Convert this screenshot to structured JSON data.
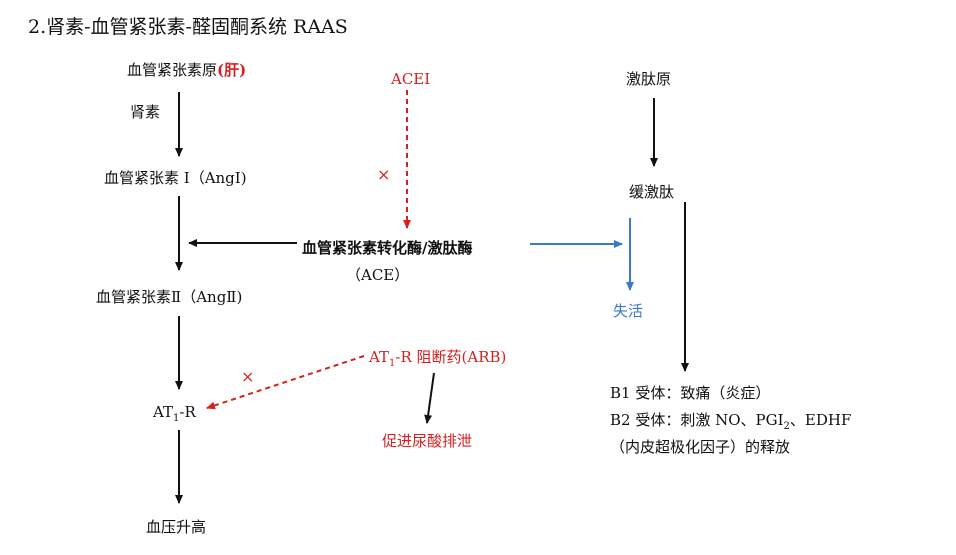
{
  "title": "2.肾素-血管紧张素-醛固酮系统 RAAS",
  "colors": {
    "black": "#111111",
    "red": "#d62020",
    "blue": "#3a78c9"
  },
  "left_column": {
    "angiotensinogen": "血管紧张素原",
    "liver_tag": "(肝)",
    "renin": "肾素",
    "ang1": "血管紧张素 I（AngI)",
    "ang2": "血管紧张素Ⅱ（AngⅡ)",
    "at1r_prefix": "AT",
    "at1r_sub": "1",
    "at1r_suffix": "-R",
    "bp_rise": "血压升高"
  },
  "middle_column": {
    "acei": "ACEI",
    "x_mark": "×",
    "ace_line1": "血管紧张素转化酶/激肽酶",
    "ace_line2": "（ACE）",
    "arb_prefix": "AT",
    "arb_sub": "1",
    "arb_suffix": "-R 阻断药(ARB)",
    "promote_uric": "促进尿酸排泄"
  },
  "right_column": {
    "kininogen": "激肽原",
    "bradykinin": "缓激肽",
    "inactivation": "失活",
    "b1": "B1 受体：致痛（炎症）",
    "b2_prefix": "B2 受体：刺激 NO、PGI",
    "b2_sub": "2",
    "b2_suffix": "、EDHF",
    "b2_line2": "（内皮超极化因子）的释放"
  }
}
